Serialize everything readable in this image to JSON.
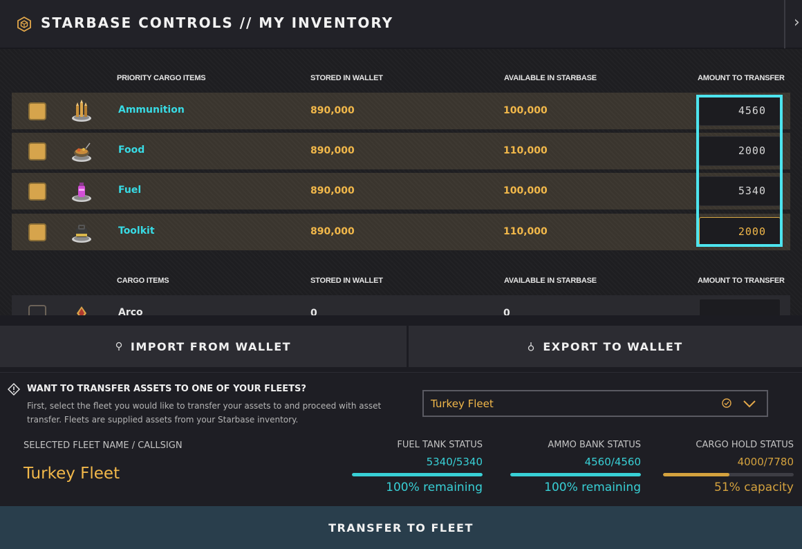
{
  "header": {
    "title": "STARBASE CONTROLS // MY INVENTORY",
    "logo_icon": "hexagon-cube-icon",
    "close_icon": "chevron-right-icon"
  },
  "priority_table": {
    "columns": [
      "PRIORITY CARGO ITEMS",
      "STORED IN WALLET",
      "AVAILABLE IN STARBASE",
      "AMOUNT TO TRANSFER"
    ],
    "rows": [
      {
        "name": "Ammunition",
        "stored": "890,000",
        "available": "100,000",
        "amount": "4560",
        "checked": true,
        "icon": "ammunition-icon"
      },
      {
        "name": "Food",
        "stored": "890,000",
        "available": "110,000",
        "amount": "2000",
        "checked": true,
        "icon": "food-icon"
      },
      {
        "name": "Fuel",
        "stored": "890,000",
        "available": "100,000",
        "amount": "5340",
        "checked": true,
        "icon": "fuel-icon"
      },
      {
        "name": "Toolkit",
        "stored": "890,000",
        "available": "110,000",
        "amount": "2000",
        "checked": true,
        "icon": "toolkit-icon"
      }
    ]
  },
  "cargo_table": {
    "columns": [
      "CARGO ITEMS",
      "STORED IN WALLET",
      "AVAILABLE IN STARBASE",
      "AMOUNT TO TRANSFER"
    ],
    "rows": [
      {
        "name": "Arco",
        "stored": "0",
        "available": "0",
        "amount": "",
        "checked": false,
        "icon": "arco-icon"
      }
    ]
  },
  "actions": {
    "import_label": "IMPORT FROM WALLET",
    "import_icon": "import-icon",
    "export_label": "EXPORT TO WALLET",
    "export_icon": "export-icon"
  },
  "fleet": {
    "question": "WANT TO TRANSFER ASSETS TO ONE OF YOUR FLEETS?",
    "description": "First, select the fleet you would like to transfer your assets to and proceed with asset transfer. Fleets are supplied assets from your Starbase inventory.",
    "selected_option": "Turkey Fleet",
    "selected_label": "SELECTED FLEET NAME / CALLSIGN",
    "selected_name": "Turkey Fleet",
    "stats": [
      {
        "label": "FUEL TANK STATUS",
        "value": "5340/5340",
        "sub": "100% remaining",
        "fill": 1.0
      },
      {
        "label": "AMMO BANK STATUS",
        "value": "4560/4560",
        "sub": "100% remaining",
        "fill": 1.0
      },
      {
        "label": "CARGO HOLD STATUS",
        "value": "4000/7780",
        "sub": "51% capacity",
        "fill": 0.51
      }
    ]
  },
  "transfer_label": "TRANSFER TO FLEET",
  "colors": {
    "accent_cyan": "#38dbe5",
    "accent_gold": "#f2b84a",
    "highlight": "#4de4ee",
    "button_blue": "#293e4c"
  }
}
